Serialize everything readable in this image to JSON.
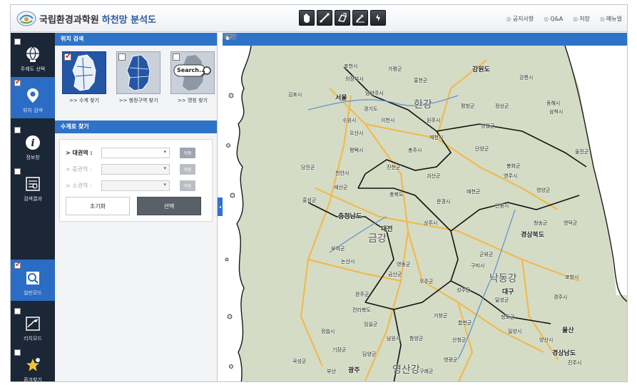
{
  "app": {
    "title_part1": "국립환경과학원",
    "title_part2": "하천망 분석도"
  },
  "header": {
    "toolbar_icons": [
      "pan-icon",
      "measure-distance-icon",
      "measure-area-icon",
      "measure-clear-icon",
      "refresh-icon"
    ],
    "menu": [
      {
        "label": "공지사항",
        "icon": "notice-icon"
      },
      {
        "label": "Q&A",
        "icon": "qna-icon"
      },
      {
        "label": "저장",
        "icon": "save-icon"
      },
      {
        "label": "매뉴얼",
        "icon": "manual-icon"
      }
    ]
  },
  "rail": {
    "items": [
      {
        "label": "주제도 선택",
        "icon": "globe-icon",
        "checked": false,
        "active": false
      },
      {
        "label": "위치 검색",
        "icon": "location-pin-icon",
        "checked": true,
        "active": true
      },
      {
        "label": "정보창",
        "icon": "info-icon",
        "checked": false,
        "active": false
      },
      {
        "label": "검색결과",
        "icon": "search-results-icon",
        "checked": false,
        "active": false
      },
      {
        "label": "일반모드",
        "icon": "general-mode-icon",
        "checked": true,
        "active": true
      },
      {
        "label": "리치모드",
        "icon": "reach-mode-icon",
        "checked": false,
        "active": false
      },
      {
        "label": "즐겨찾기",
        "icon": "favorite-star-icon",
        "checked": false,
        "active": false
      }
    ]
  },
  "panel": {
    "location_search_title": "위치 검색",
    "search_types": [
      {
        "caption": ">> 수계 찾기",
        "selected": true
      },
      {
        "caption": ">> 행정구역 찾기",
        "selected": false
      },
      {
        "caption": ">> 명칭 찾기",
        "selected": false,
        "thumb_text": "Search..."
      }
    ],
    "basin_search_title": "수계로 찾기",
    "fields": [
      {
        "label": "> 대권역 :",
        "value": "",
        "go": "이동",
        "enabled": true
      },
      {
        "label": "> 중권역 :",
        "value": "",
        "go": "이동",
        "enabled": false
      },
      {
        "label": "> 소권역 :",
        "value": "",
        "go": "이동",
        "enabled": false
      }
    ],
    "reset_label": "초기화",
    "select_label": "선택"
  },
  "map": {
    "places": [
      {
        "text": "포천시"
      },
      {
        "text": "가평군"
      },
      {
        "text": "강원도",
        "cls": "mid"
      },
      {
        "text": "의정부시"
      },
      {
        "text": "홍천군"
      },
      {
        "text": "강릉시"
      },
      {
        "text": "김포시"
      },
      {
        "text": "서울",
        "cls": "mid"
      },
      {
        "text": "남양주시"
      },
      {
        "text": "한강",
        "cls": "big"
      },
      {
        "text": "동해시"
      },
      {
        "text": "삼척시"
      },
      {
        "text": "경기도"
      },
      {
        "text": "평창군"
      },
      {
        "text": "정선군"
      },
      {
        "text": "수원시"
      },
      {
        "text": "이천시"
      },
      {
        "text": "원주시"
      },
      {
        "text": "영월군"
      },
      {
        "text": "오산시"
      },
      {
        "text": "제천시"
      },
      {
        "text": "평택시"
      },
      {
        "text": "충주시"
      },
      {
        "text": "단양군"
      },
      {
        "text": "울진군"
      },
      {
        "text": "당진군"
      },
      {
        "text": "진천군"
      },
      {
        "text": "봉화군"
      },
      {
        "text": "천안시"
      },
      {
        "text": "영주시"
      },
      {
        "text": "괴산군"
      },
      {
        "text": "예산군"
      },
      {
        "text": "충북도"
      },
      {
        "text": "영양군"
      },
      {
        "text": "홍성군"
      },
      {
        "text": "예천군"
      },
      {
        "text": "문경시"
      },
      {
        "text": "안동시"
      },
      {
        "text": "충청남도",
        "cls": "mid"
      },
      {
        "text": "상주시"
      },
      {
        "text": "청송군"
      },
      {
        "text": "영덕군"
      },
      {
        "text": "금강",
        "cls": "big"
      },
      {
        "text": "대전",
        "cls": "mid"
      },
      {
        "text": "경상북도",
        "cls": "mid"
      },
      {
        "text": "부여군"
      },
      {
        "text": "논산시"
      },
      {
        "text": "군위군"
      },
      {
        "text": "영동군"
      },
      {
        "text": "구미시"
      },
      {
        "text": "금산군"
      },
      {
        "text": "낙동강",
        "cls": "big"
      },
      {
        "text": "포항시"
      },
      {
        "text": "무주군"
      },
      {
        "text": "성주군"
      },
      {
        "text": "대구",
        "cls": "mid"
      },
      {
        "text": "경주시"
      },
      {
        "text": "완주군"
      },
      {
        "text": "달성군"
      },
      {
        "text": "전라북도"
      },
      {
        "text": "임실군"
      },
      {
        "text": "거창군"
      },
      {
        "text": "청도군"
      },
      {
        "text": "울산",
        "cls": "mid"
      },
      {
        "text": "합천군"
      },
      {
        "text": "밀양시"
      },
      {
        "text": "정읍시"
      },
      {
        "text": "남원시"
      },
      {
        "text": "함양군"
      },
      {
        "text": "산청군"
      },
      {
        "text": "양산시"
      },
      {
        "text": "경상남도",
        "cls": "mid"
      },
      {
        "text": "기장군"
      },
      {
        "text": "담양군"
      },
      {
        "text": "곡성군"
      },
      {
        "text": "영광군"
      },
      {
        "text": "진주시"
      },
      {
        "text": "부산"
      },
      {
        "text": "광주",
        "cls": "mid"
      },
      {
        "text": "영산강",
        "cls": "big"
      },
      {
        "text": "구례군"
      },
      {
        "text": "하동군"
      }
    ]
  },
  "colors": {
    "accent": "#2f73c8",
    "rail_bg": "#1b2636",
    "land": "#d4dcc5",
    "sea": "#ffffff",
    "road": "#f2b84b",
    "border": "#111111"
  }
}
